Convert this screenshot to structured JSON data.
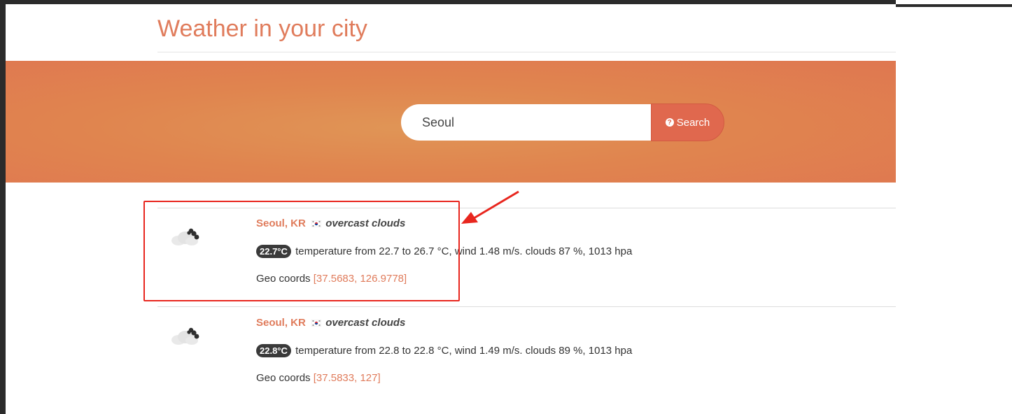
{
  "page": {
    "title": "Weather in your city"
  },
  "search": {
    "value": "Seoul",
    "button_label": "Search",
    "button_icon": "question-circle-icon"
  },
  "colors": {
    "accent": "#e07c5c",
    "hero": "#e0854f",
    "button": "#e0684e",
    "annotation": "#e8261e"
  },
  "results": [
    {
      "city": "Seoul, KR",
      "flag": "kr-flag-icon",
      "description": "overcast clouds",
      "icon": "overcast-clouds-icon",
      "temp": "22.7°C",
      "details": "temperature from 22.7 to 26.7 °C, wind 1.48 m/s. clouds 87 %, 1013 hpa",
      "geo_label": "Geo coords",
      "coords": "[37.5683, 126.9778]"
    },
    {
      "city": "Seoul, KR",
      "flag": "kr-flag-icon",
      "description": "overcast clouds",
      "icon": "overcast-clouds-icon",
      "temp": "22.8°C",
      "details": "temperature from 22.8 to 22.8 °C, wind 1.49 m/s. clouds 89 %, 1013 hpa",
      "geo_label": "Geo coords",
      "coords": "[37.5833, 127]"
    }
  ]
}
